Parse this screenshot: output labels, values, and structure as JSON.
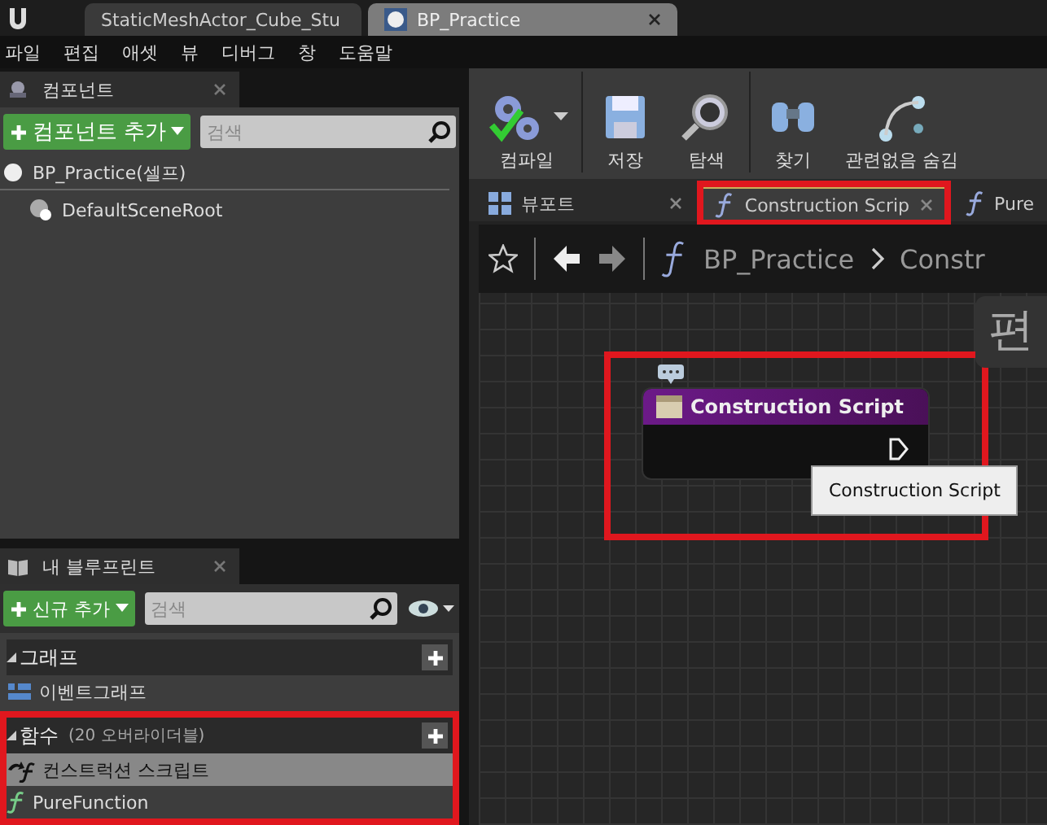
{
  "doc_tabs": [
    {
      "label": "StaticMeshActor_Cube_Stu",
      "selected": false
    },
    {
      "label": "BP_Practice",
      "selected": true
    }
  ],
  "menu": [
    "파일",
    "편집",
    "애셋",
    "뷰",
    "디버그",
    "창",
    "도움말"
  ],
  "components_panel": {
    "title": "컴포넌트",
    "add_button": "컴포넌트 추가",
    "search": {
      "placeholder": "검색"
    },
    "root": {
      "label": "BP_Practice(셀프)",
      "children": [
        {
          "label": "DefaultSceneRoot"
        }
      ]
    }
  },
  "blueprint_panel": {
    "title": "내 블루프린트",
    "add_button": "신규 추가",
    "search": {
      "placeholder": "검색"
    },
    "sections": [
      {
        "title": "그래프",
        "highlighted": false,
        "items": [
          {
            "label": "이벤트그래프",
            "kind": "graph",
            "selected": false
          }
        ]
      },
      {
        "title": "함수",
        "note": "(20 오버라이더블)",
        "highlighted": true,
        "items": [
          {
            "label": "컨스트럭션 스크립트",
            "kind": "construction",
            "selected": true
          },
          {
            "label": "PureFunction",
            "kind": "function",
            "selected": false
          }
        ]
      }
    ]
  },
  "toolbar": [
    {
      "label": "컴파일",
      "kind": "compile",
      "dropdown": true
    },
    {
      "label": "저장",
      "kind": "save",
      "dropdown": false
    },
    {
      "label": "탐색",
      "kind": "browse",
      "dropdown": false
    },
    {
      "label": "찾기",
      "kind": "find",
      "dropdown": false
    },
    {
      "label": "관련없음 숨김",
      "kind": "hide",
      "dropdown": false
    }
  ],
  "graph_tabs": [
    {
      "label": "뷰포트",
      "kind": "viewport",
      "selected": false,
      "highlighted": false,
      "closable": true
    },
    {
      "label": "Construction Scrip",
      "kind": "function",
      "selected": true,
      "highlighted": true,
      "closable": true
    },
    {
      "label": "Pure",
      "kind": "function",
      "selected": false,
      "highlighted": false,
      "closable": false
    }
  ],
  "breadcrumb": [
    "BP_Practice",
    "Constr"
  ],
  "graph": {
    "watermark_text": "편",
    "node": {
      "title": "Construction Script",
      "highlighted": true
    },
    "tooltip": "Construction Script"
  }
}
